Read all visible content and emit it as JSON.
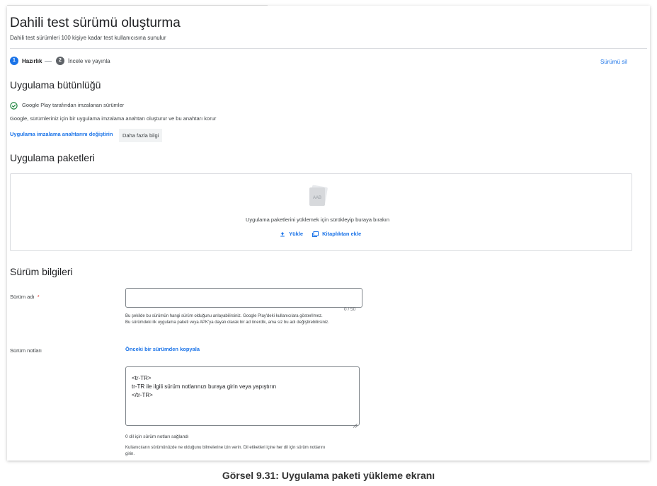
{
  "header": {
    "title": "Dahili test sürümü oluşturma",
    "subtitle": "Dahili test sürümleri 100 kişiye kadar test kullanıcısına sunulur"
  },
  "stepper": {
    "step1": {
      "number": "1",
      "label": "Hazırlık"
    },
    "step2": {
      "number": "2",
      "label": "İncele ve yayınla"
    },
    "delete_label": "Sürümü sil"
  },
  "integrity": {
    "heading": "Uygulama bütünlüğü",
    "status": "Google Play tarafından imzalanan sürümler",
    "description": "Google, sürümleriniz için bir uygulama imzalama anahtarı oluşturur ve bu anahtarı korur",
    "change_key_link": "Uygulama imzalama anahtarını değiştirin",
    "more_info_button": "Daha fazla bilgi"
  },
  "bundles": {
    "heading": "Uygulama paketleri",
    "icon_text": "AAB",
    "drop_text": "Uygulama paketlerini yüklemek için sürükleyip buraya bırakın",
    "upload_label": "Yükle",
    "library_label": "Kitaplıktan ekle"
  },
  "release": {
    "heading": "Sürüm bilgileri",
    "name_label": "Sürüm adı",
    "required_mark": "*",
    "name_value": "",
    "char_counter": "0 / 50",
    "name_help_1": "Bu şekilde bu sürümün hangi sürüm olduğunu anlayabilirsiniz. Google Play'deki kullanıcılara gösterilmez.",
    "name_help_2": "Bu sürümdeki ilk uygulama paketi veya APK'ya dayalı olarak bir ad önerdik, ama siz bu adı değiştirebilirsiniz.",
    "notes_label": "Sürüm notları",
    "copy_link": "Önceki bir sürümden kopyala",
    "notes_lines": [
      "<tr-TR>",
      "tr-TR ile ilgili sürüm notlarınızı buraya girin veya yapıştırın",
      "</tr-TR>"
    ],
    "notes_count": "0 dil için sürüm notları sağlandı",
    "notes_help_1": "Kullanıcıların sürümünüzde ne olduğunu bilmelerine izin verin. Dil etiketleri içine her dil için sürüm notlarını",
    "notes_help_2": "girin."
  },
  "caption": "Görsel 9.31: Uygulama paketi yükleme ekranı",
  "colors": {
    "accent": "#1a73e8",
    "success": "#188038",
    "border": "#dadce0"
  }
}
